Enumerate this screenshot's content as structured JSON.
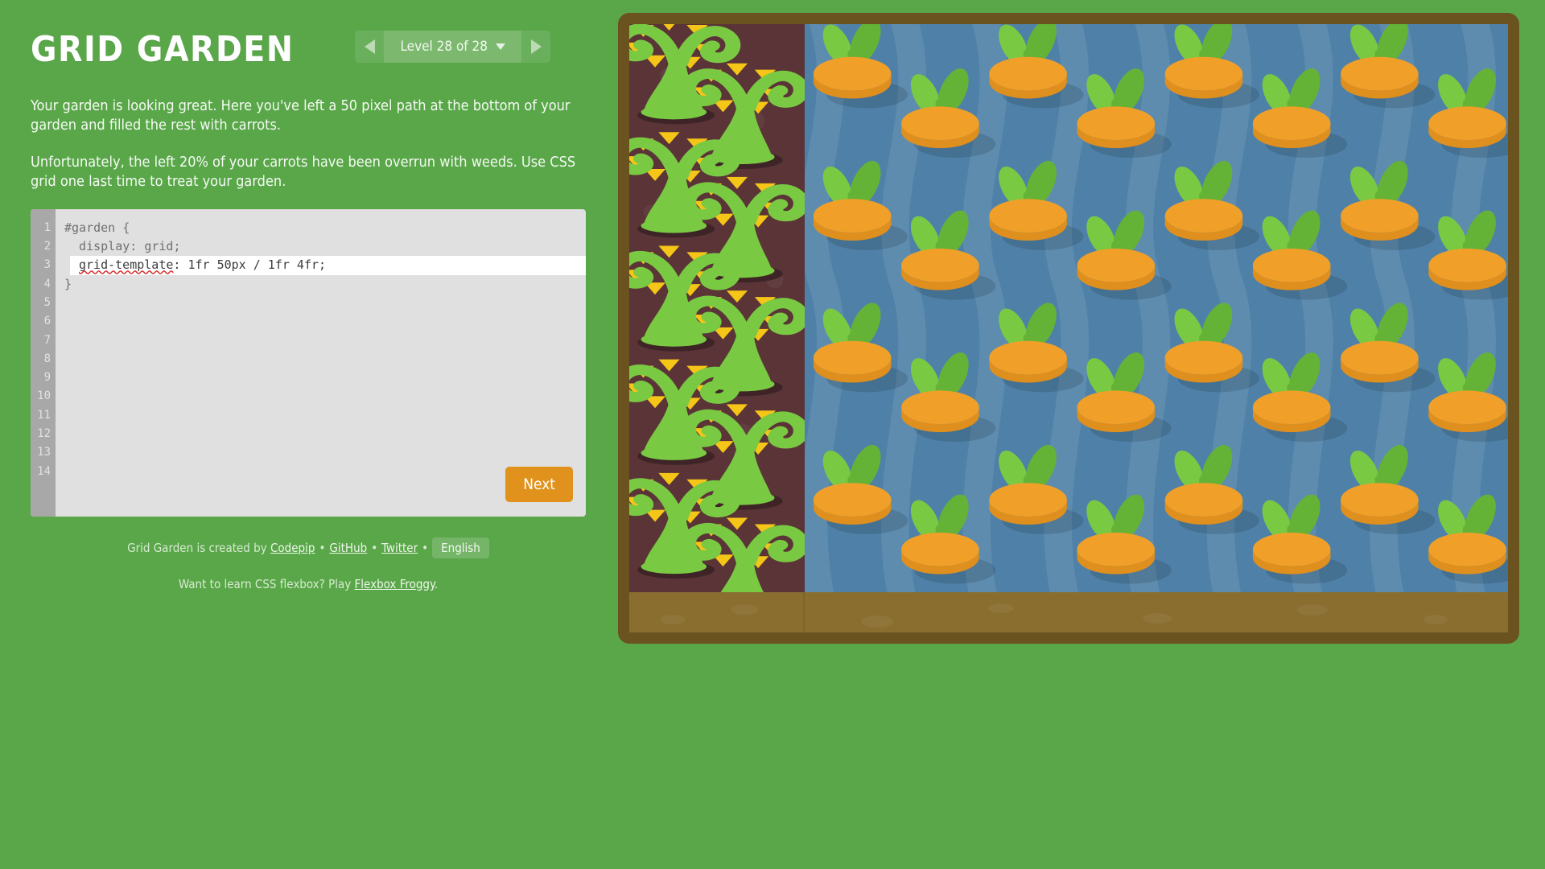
{
  "app": {
    "title": "Grid Garden"
  },
  "header": {
    "level_selector": {
      "prev_icon": "triangle-left-icon",
      "next_icon": "triangle-right-icon",
      "caret_icon": "caret-down-icon",
      "label": "Level 28 of 28",
      "current_level": 28,
      "total_levels": 28
    }
  },
  "instructions": {
    "paragraph1": "Your garden is looking great. Here you've left a 50 pixel path at the bottom of your garden and filled the rest with carrots.",
    "paragraph2": "Unfortunately, the left 20% of your carrots have been overrun with weeds. Use CSS grid one last time to treat your garden."
  },
  "editor": {
    "line_numbers": [
      "1",
      "2",
      "3",
      "4",
      "5",
      "6",
      "7",
      "8",
      "9",
      "10",
      "11",
      "12",
      "13",
      "14"
    ],
    "active_line_index": 2,
    "lines": [
      "#garden {",
      "  display: grid;",
      "  grid-template: 1fr 50px / 1fr 4fr;",
      "}"
    ],
    "active_line": {
      "property": "grid-template",
      "separator": ": ",
      "value": "1fr 50px / 1fr 4fr;",
      "spellcheck_error": true
    },
    "next_button_label": "Next"
  },
  "footer": {
    "credit_prefix": "Grid Garden is created by ",
    "codepip_link": "Codepip",
    "github_link": "GitHub",
    "twitter_link": "Twitter",
    "separator": "•",
    "language_button": "English",
    "flexbox_prefix": "Want to learn CSS flexbox? Play ",
    "flexbox_link": "Flexbox Froggy",
    "flexbox_suffix": "."
  },
  "garden": {
    "grid_template": "1fr 50px / 1fr 4fr",
    "columns": [
      "1fr",
      "4fr"
    ],
    "rows": [
      "1fr",
      "50px"
    ],
    "cells": [
      {
        "name": "weeds",
        "content": "weeds",
        "row": 1,
        "col": 1
      },
      {
        "name": "carrots",
        "content": "carrots",
        "row": 1,
        "col": 2
      },
      {
        "name": "path-left",
        "content": "path",
        "row": 2,
        "col": 1
      },
      {
        "name": "path-right",
        "content": "path",
        "row": 2,
        "col": 2
      }
    ],
    "weed_rows": 5,
    "weeds_per_row": 2,
    "carrot_rows": 4,
    "carrots_per_row": 8
  },
  "colors": {
    "page_background": "#5aa74a",
    "garden_border": "#6b5320",
    "weed_soil": "#5a3437",
    "carrot_soil": "#4f81a8",
    "path_dirt": "#8a6e30",
    "carrot_orange": "#f0a028",
    "carrot_orange_dark": "#de8f1e",
    "leaf_green": "#7ac943",
    "leaf_green_dark": "#64b336",
    "weed_green": "#7ac943",
    "weed_thorn": "#f5c518",
    "editor_background": "#e0e0e0",
    "editor_gutter": "#a8a8a8",
    "next_button": "#e0921c",
    "spellcheck_underline": "#d82b2b"
  }
}
